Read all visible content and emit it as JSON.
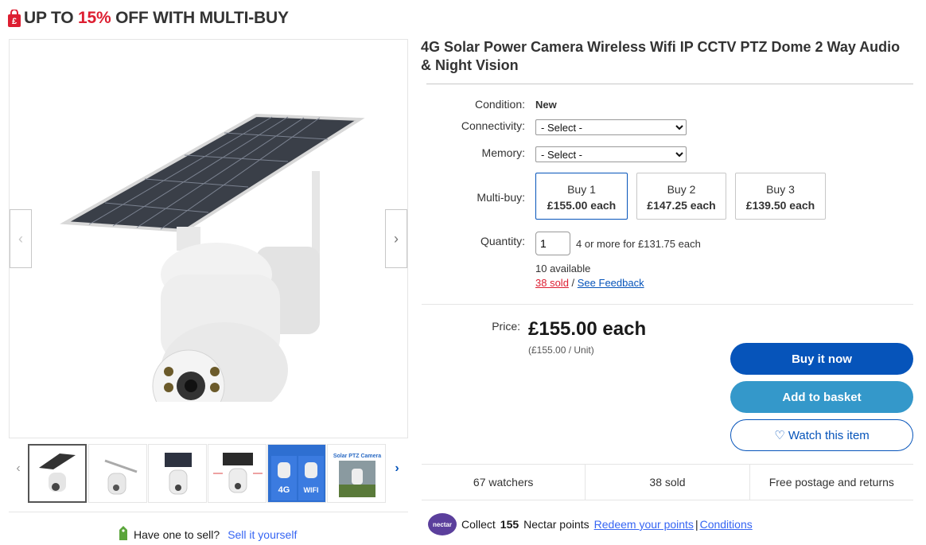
{
  "promo": {
    "prefix": "UP TO ",
    "percent": "15%",
    "suffix": " OFF WITH MULTI-BUY"
  },
  "title": "4G Solar Power Camera Wireless Wifi IP CCTV PTZ Dome 2 Way Audio & Night Vision",
  "condition": {
    "label": "Condition:",
    "value": "New"
  },
  "connectivity": {
    "label": "Connectivity:",
    "selected": "- Select -"
  },
  "memory": {
    "label": "Memory:",
    "selected": "- Select -"
  },
  "multibuy": {
    "label": "Multi-buy:",
    "options": [
      {
        "qty": "Buy 1",
        "price": "£155.00 each"
      },
      {
        "qty": "Buy 2",
        "price": "£147.25 each"
      },
      {
        "qty": "Buy 3",
        "price": "£139.50 each"
      }
    ]
  },
  "quantity": {
    "label": "Quantity:",
    "value": "1",
    "offer": "4 or more for £131.75 each",
    "available": "10 available",
    "sold": "38 sold",
    "separator": " / ",
    "feedback": "See Feedback"
  },
  "price": {
    "label": "Price:",
    "value": "£155.00 each",
    "unit": "(£155.00 / Unit)"
  },
  "buttons": {
    "buy_now": "Buy it now",
    "add_basket": "Add to basket",
    "watch": "♡ Watch this item"
  },
  "stats": {
    "watchers": "67 watchers",
    "sold": "38 sold",
    "postage": "Free postage and returns"
  },
  "sell": {
    "question": "Have one to sell?",
    "link": "Sell it yourself"
  },
  "nectar": {
    "logo_text": "nectar",
    "collect": "Collect",
    "points": "155",
    "points_suffix": "Nectar points",
    "redeem": "Redeem your points",
    "sep": " | ",
    "conditions": "Conditions"
  },
  "thumbnails": [
    "thumb-1",
    "thumb-2",
    "thumb-3",
    "thumb-4",
    "thumb-5",
    "thumb-6"
  ],
  "thumb_texts": {
    "t5_a": "4G",
    "t5_b": "WIFI",
    "t6_title": "Solar PTZ Camera"
  },
  "colors": {
    "accent": "#0654ba",
    "basket": "#3498ca",
    "sale_red": "#dd1e31",
    "link": "#3665f3"
  }
}
